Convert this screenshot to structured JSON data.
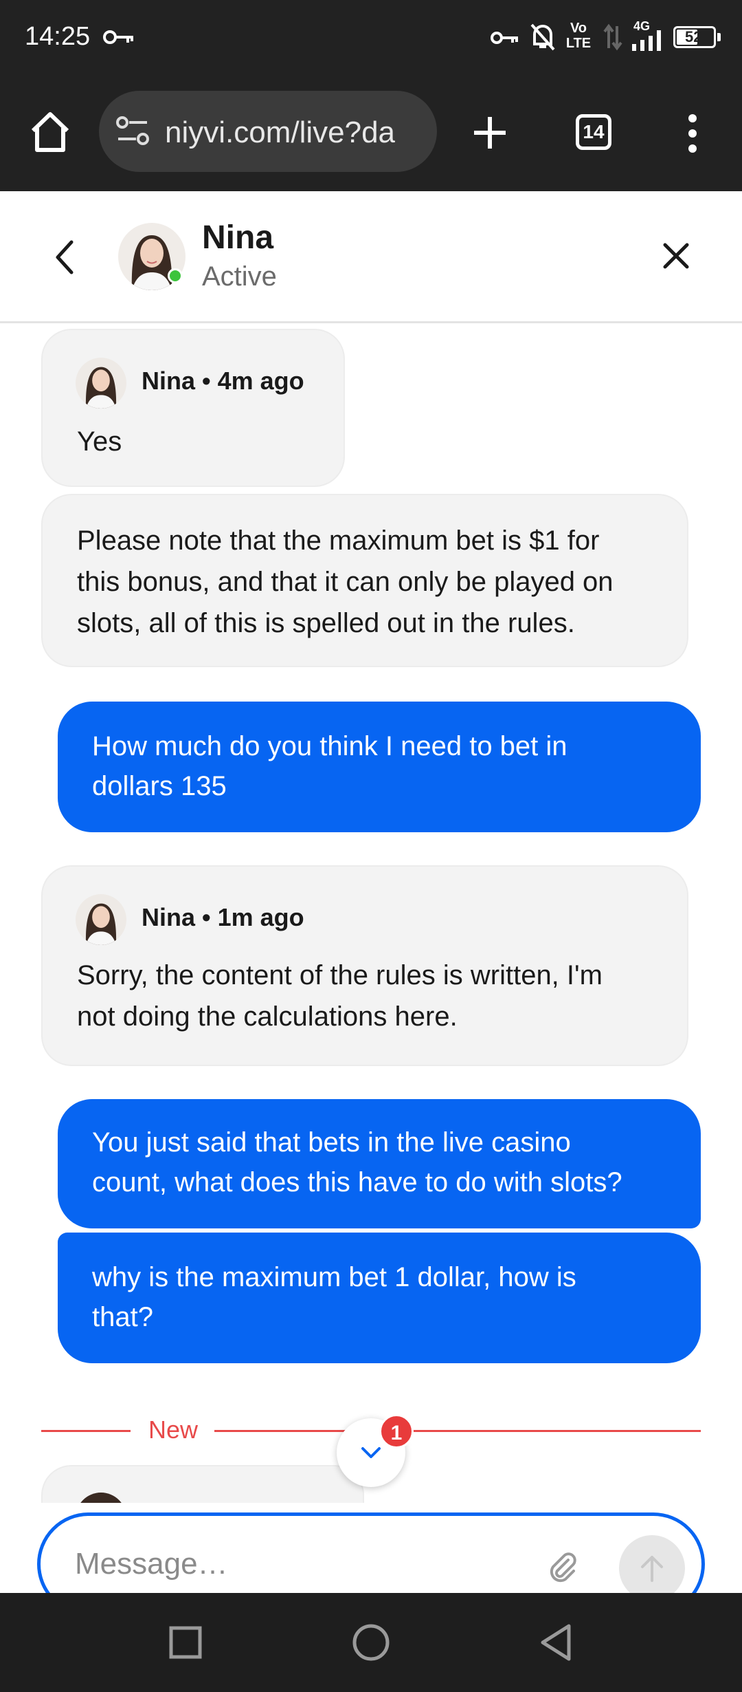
{
  "status_bar": {
    "time": "14:25",
    "network_label": "4G",
    "volte_label": "Vo LTE",
    "battery": "52",
    "icons": [
      "key-icon",
      "vpn-key-icon",
      "bell-off-icon",
      "volte-icon",
      "data-arrows-icon",
      "signal-icon",
      "battery-icon"
    ]
  },
  "browser": {
    "url": "niyvi.com/live?da",
    "tab_count": "14",
    "icons": [
      "home-icon",
      "site-settings-icon",
      "new-tab-plus-icon",
      "tabs-icon",
      "more-vert-icon"
    ]
  },
  "chat_header": {
    "agent_name": "Nina",
    "agent_status": "Active",
    "online_color": "#3cc43c"
  },
  "messages": [
    {
      "type": "incoming",
      "author": "Nina",
      "time_ago": "4m ago",
      "meta": "Nina • 4m ago",
      "text": "Yes"
    },
    {
      "type": "incoming",
      "text_lines": [
        "Please note that the maximum bet is $1 for",
        "this bonus, and that it can only be played on",
        "slots, all of this is spelled out in the rules."
      ]
    },
    {
      "type": "outgoing",
      "text_lines": [
        "How much do you think I need to bet in",
        "dollars 135"
      ]
    },
    {
      "type": "incoming",
      "author": "Nina",
      "time_ago": "1m ago",
      "meta": "Nina • 1m ago",
      "text_lines": [
        "Sorry, the content of the rules is written, I'm",
        "not doing the calculations here."
      ]
    },
    {
      "type": "outgoing",
      "text_lines": [
        "You just said that bets in the live casino",
        "count, what does this have to do with slots?"
      ]
    },
    {
      "type": "outgoing",
      "text_lines": [
        "why is the maximum bet 1 dollar, how is",
        "that?"
      ]
    }
  ],
  "new_divider": {
    "label": "New"
  },
  "scroll_down": {
    "unread_count": "1"
  },
  "composer": {
    "placeholder": "Message…"
  },
  "nav_bar": {
    "icons": [
      "recents-square-icon",
      "home-circle-icon",
      "back-triangle-icon"
    ]
  },
  "colors": {
    "accent": "#0765f2",
    "incoming_bubble": "#f3f3f3",
    "new_divider": "#e84a4a",
    "badge": "#e83b3b",
    "system_bar": "#222222"
  }
}
